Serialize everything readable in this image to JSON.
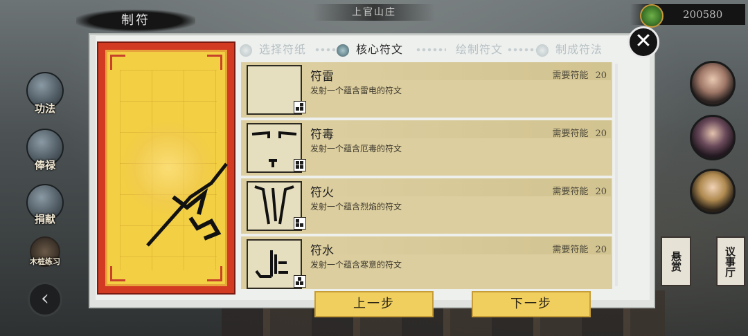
{
  "header": {
    "location_title": "上官山庄",
    "window_title": "制符",
    "currency_value": "200580",
    "currency_icon": "gourd-coin-icon"
  },
  "left_menu": [
    {
      "label": "功法",
      "icon": "book-icon"
    },
    {
      "label": "俸禄",
      "icon": "handshake-icon"
    },
    {
      "label": "捐献",
      "icon": "pouch-icon"
    },
    {
      "label": "木桩练习",
      "icon": "training-dummy-icon"
    }
  ],
  "right_banners": [
    {
      "label": "悬赏"
    },
    {
      "label": "议事厅"
    }
  ],
  "wizard": {
    "steps": [
      {
        "label": "选择符纸",
        "active": false
      },
      {
        "label": "核心符文",
        "active": true
      },
      {
        "label": "绘制符文",
        "active": false
      },
      {
        "label": "制成符法",
        "active": false
      }
    ]
  },
  "runes": [
    {
      "name": "符雷",
      "desc": "发射一个蕴含雷电的符文",
      "req_label": "需要符能",
      "req_value": "20"
    },
    {
      "name": "符毒",
      "desc": "发射一个蕴含厄毒的符文",
      "req_label": "需要符能",
      "req_value": "20"
    },
    {
      "name": "符火",
      "desc": "发射一个蕴含烈焰的符文",
      "req_label": "需要符能",
      "req_value": "20"
    },
    {
      "name": "符水",
      "desc": "发射一个蕴含寒意的符文",
      "req_label": "需要符能",
      "req_value": "20"
    }
  ],
  "buttons": {
    "prev": "上一步",
    "next": "下一步",
    "close_icon": "close-icon"
  },
  "colors": {
    "talisman_red": "#d23b22",
    "talisman_yellow": "#f2cf43",
    "button_gold": "#f1cf5e",
    "row_bg": "#dcce9f"
  }
}
